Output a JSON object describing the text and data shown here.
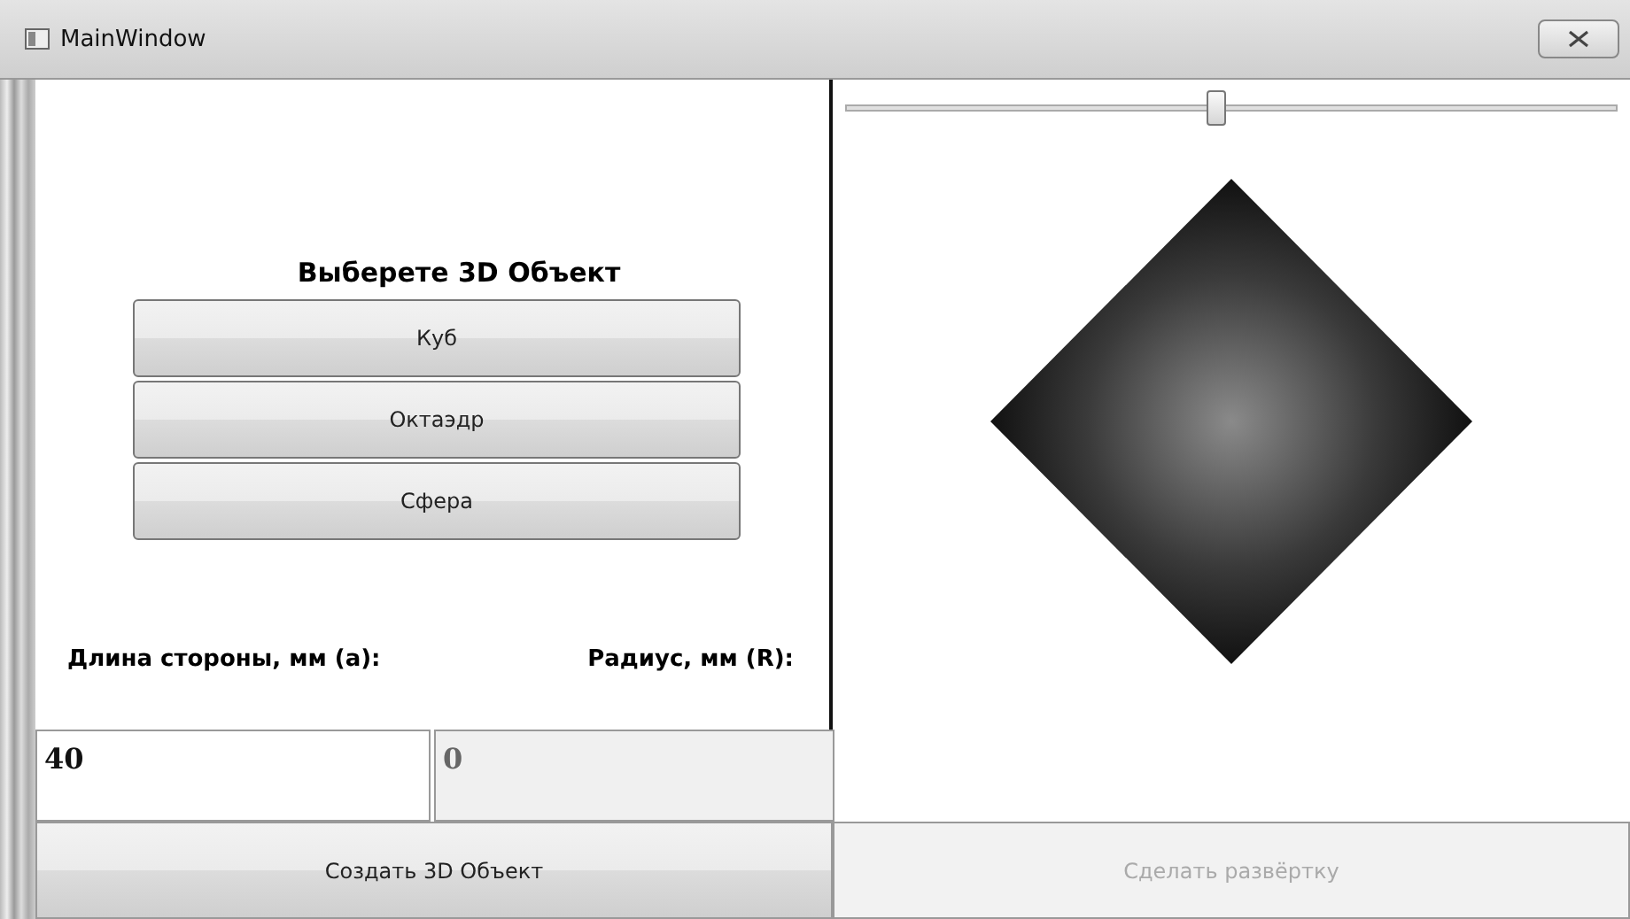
{
  "window": {
    "title": "MainWindow"
  },
  "left_panel": {
    "heading": "Выберете 3D Объект",
    "object_buttons": [
      {
        "label": "Куб"
      },
      {
        "label": "Октаэдр"
      },
      {
        "label": "Сфера"
      }
    ],
    "fields": [
      {
        "label": "Длина стороны, мм (a):",
        "value": "40",
        "disabled": false
      },
      {
        "label": "Радиус, мм (R):",
        "value": "0",
        "disabled": true
      }
    ]
  },
  "right_panel": {
    "slider": {
      "level": 0.48
    }
  },
  "bottom_buttons": [
    {
      "label": "Создать 3D Объект",
      "disabled": false
    },
    {
      "label": "Сделать развёртку",
      "disabled": true
    }
  ]
}
